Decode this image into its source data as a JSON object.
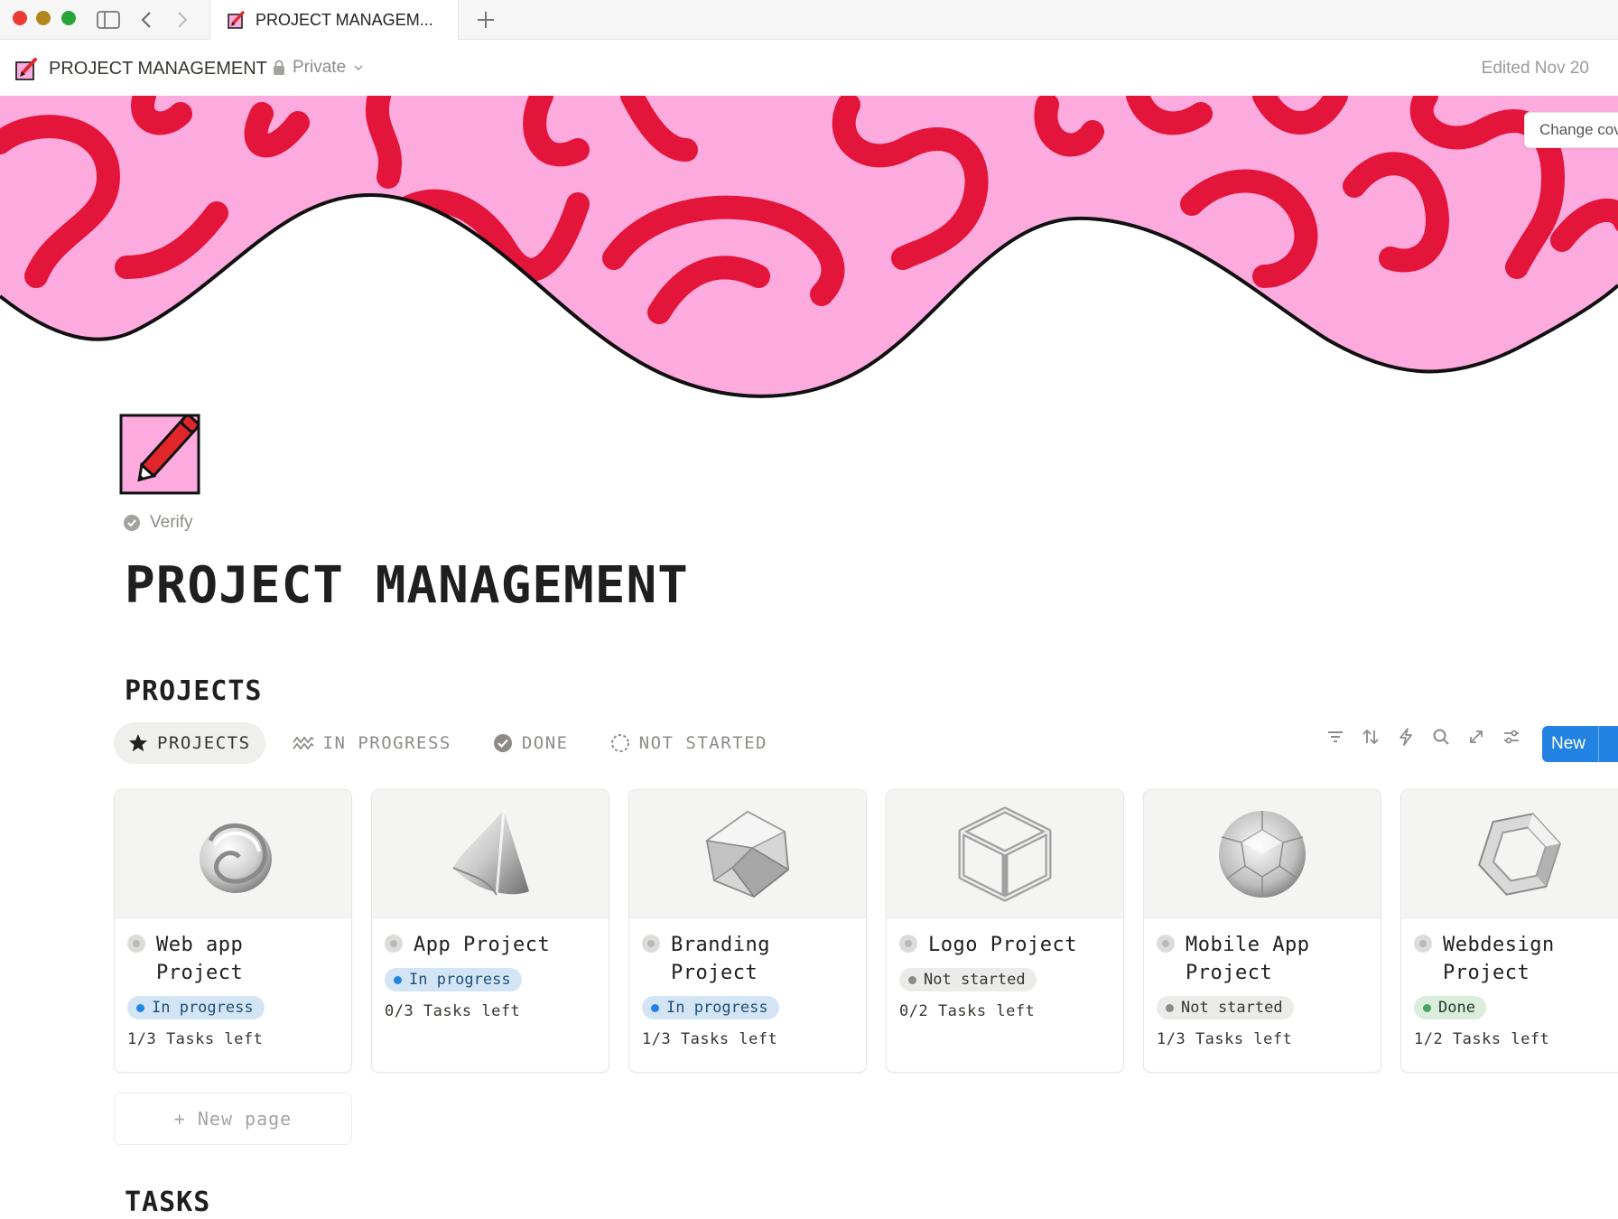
{
  "browser": {
    "tab_title": "PROJECT MANAGEM...",
    "tab_icon": "memo-pencil-icon",
    "traffic_colors": [
      "#ec3b35",
      "#b2861f",
      "#28a43a"
    ]
  },
  "topbar": {
    "breadcrumb_title": "PROJECT MANAGEMENT",
    "privacy_label": "Private",
    "edited_label": "Edited Nov 20"
  },
  "cover": {
    "change_cover_label": "Change cov",
    "background_color": "#fdaadf",
    "squiggle_color": "#e4153a"
  },
  "page": {
    "verify_label": "Verify",
    "title": "PROJECT MANAGEMENT"
  },
  "projects_section": {
    "heading": "PROJECTS",
    "views": [
      {
        "label": "PROJECTS",
        "icon": "star-icon",
        "active": true
      },
      {
        "label": "IN PROGRESS",
        "icon": "zigzag-icon",
        "active": false
      },
      {
        "label": "DONE",
        "icon": "check-circle-icon",
        "active": false
      },
      {
        "label": "NOT STARTED",
        "icon": "dashed-circle-icon",
        "active": false
      }
    ],
    "tools": [
      "filter-icon",
      "sort-icon",
      "automation-bolt-icon",
      "search-icon",
      "expand-icon",
      "settings-sliders-icon"
    ],
    "new_button_label": "New",
    "cards": [
      {
        "title": "Web app Project",
        "shape": "swirl-glass-shape",
        "status": "In progress",
        "tasks": "1/3 Tasks left"
      },
      {
        "title": "App Project",
        "shape": "cone-glass-shape",
        "status": "In progress",
        "tasks": "0/3 Tasks left"
      },
      {
        "title": "Branding Project",
        "shape": "polyhedron-glass-shape",
        "status": "In progress",
        "tasks": "1/3 Tasks left"
      },
      {
        "title": "Logo Project",
        "shape": "wire-cube-shape",
        "status": "Not started",
        "tasks": "0/2 Tasks left"
      },
      {
        "title": "Mobile App Project",
        "shape": "faceted-sphere-shape",
        "status": "Not started",
        "tasks": "1/3 Tasks left"
      },
      {
        "title": "Webdesign Project",
        "shape": "hexagon-ring-shape",
        "status": "Done",
        "tasks": "1/2 Tasks left"
      }
    ],
    "status_colors": {
      "In progress": {
        "bg": "#d3e5f5",
        "dot": "#2383e2",
        "text": "#1e4f7a"
      },
      "Not started": {
        "bg": "#ebebea",
        "dot": "#8c8b87",
        "text": "#37352f"
      },
      "Done": {
        "bg": "#dbeddb",
        "dot": "#4aa361",
        "text": "#1c3829"
      }
    },
    "new_page_label": "+ New page"
  },
  "tasks_section": {
    "heading": "TASKS"
  }
}
